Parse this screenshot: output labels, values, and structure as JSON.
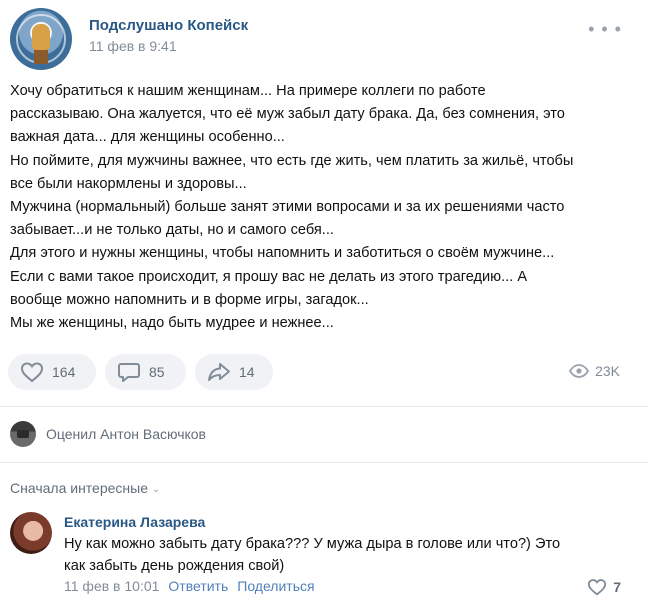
{
  "post": {
    "author": "Подслушано Копейск",
    "date": "11 фев в 9:41",
    "lines": [
      "Хочу обратиться к нашим женщинам... На примере коллеги по работе",
      "рассказываю. Она жалуется, что её муж забыл дату брака. Да, без сомнения, это",
      "важная дата... для женщины особенно...",
      "Но поймите, для мужчины важнее, что есть где жить, чем платить за жильё, чтобы",
      "все были накормлены и здоровы...",
      "Мужчина (нормальный) больше занят этими вопросами и за их решениями часто",
      "забывает...и не только даты, но и самого себя...",
      "Для этого и нужны женщины, чтобы напомнить и заботиться о своём мужчине...",
      "Если с вами такое происходит, я прошу вас не делать из этого трагедию... А",
      "вообще можно напомнить и в форме игры, загадок...",
      "Мы же женщины, надо быть мудрее и нежнее..."
    ],
    "likes": "164",
    "comments": "85",
    "shares": "14",
    "views": "23K"
  },
  "liked_by": "Оценил Антон Васючков",
  "comments_section": {
    "sort_label": "Сначала интересные",
    "comment": {
      "author": "Екатерина Лазарева",
      "text_line1": "Ну как можно забыть дату брака??? У мужа дыра в голове или что?) Это",
      "text_line2": "как забыть день рождения свой)",
      "date": "11 фев в 10:01",
      "reply": "Ответить",
      "share": "Поделиться",
      "likes": "7"
    }
  },
  "colors": {
    "link": "#2a5885",
    "secondary": "#818c99",
    "pill_bg": "#f0f2f5"
  }
}
